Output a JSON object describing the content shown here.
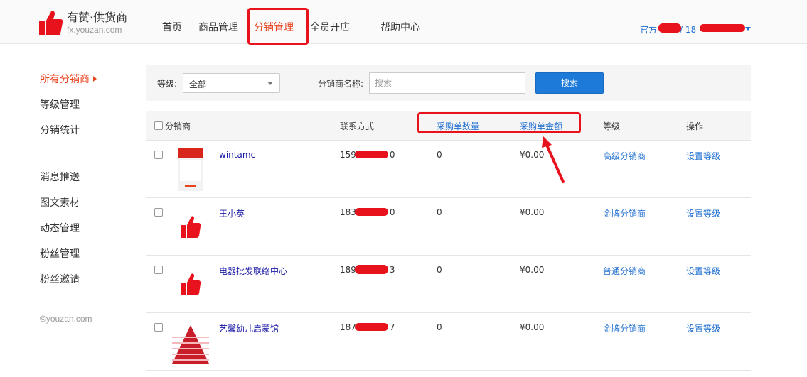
{
  "header": {
    "brand_title": "有赞·供货商",
    "brand_sub": "fx.youzan.com",
    "nav": [
      "首页",
      "商品管理",
      "分销管理",
      "全员开店",
      "帮助中心"
    ],
    "active_nav": "分销管理",
    "account_prefix": "官方",
    "account_sep": "/ 18"
  },
  "sidebar": {
    "group1": [
      "所有分销商",
      "等级管理",
      "分销统计"
    ],
    "group2": [
      "消息推送",
      "图文素材",
      "动态管理",
      "粉丝管理",
      "粉丝邀请"
    ],
    "copyright": "©youzan.com"
  },
  "filter": {
    "level_label": "等级:",
    "level_value": "全部",
    "name_label": "分销商名称:",
    "search_placeholder": "搜索",
    "search_button": "搜索"
  },
  "table": {
    "headers": {
      "distributor": "分销商",
      "contact": "联系方式",
      "order_count": "采购单数量",
      "order_amount": "采购单金额",
      "level": "等级",
      "action": "操作"
    },
    "rows": [
      {
        "name": "wintamc",
        "phone_start": "159",
        "phone_end": "0",
        "count": "0",
        "amount": "¥0.00",
        "level": "高级分销商",
        "action": "设置等级"
      },
      {
        "name": "王小英",
        "phone_start": "183",
        "phone_end": "0",
        "count": "0",
        "amount": "¥0.00",
        "level": "金牌分销商",
        "action": "设置等级"
      },
      {
        "name": "电器批发联络中心",
        "phone_start": "189",
        "phone_end": "3",
        "count": "0",
        "amount": "¥0.00",
        "level": "普通分销商",
        "action": "设置等级"
      },
      {
        "name": "艺馨幼儿启蒙馆",
        "phone_start": "187",
        "phone_end": "7",
        "count": "0",
        "amount": "¥0.00",
        "level": "金牌分销商",
        "action": "设置等级"
      }
    ]
  },
  "colors": {
    "accent": "#e8431f",
    "link": "#1f6fd1",
    "button": "#1e7ad9",
    "annotation": "#e8121d"
  },
  "icons": [
    "thumbs-up-icon",
    "caret-down-icon",
    "caret-right-icon",
    "checkbox-icon"
  ]
}
